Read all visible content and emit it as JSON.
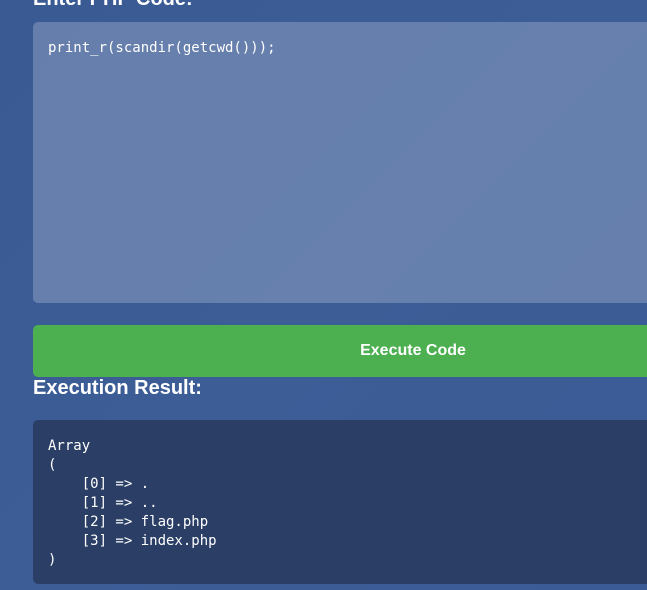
{
  "editor": {
    "heading": "Enter PHP Code:",
    "code": "print_r(scandir(getcwd()));"
  },
  "execute_button": {
    "label": "Execute Code"
  },
  "result": {
    "heading": "Execution Result:",
    "output": "Array\n(\n    [0] => .\n    [1] => ..\n    [2] => flag.php\n    [3] => index.php\n)"
  }
}
